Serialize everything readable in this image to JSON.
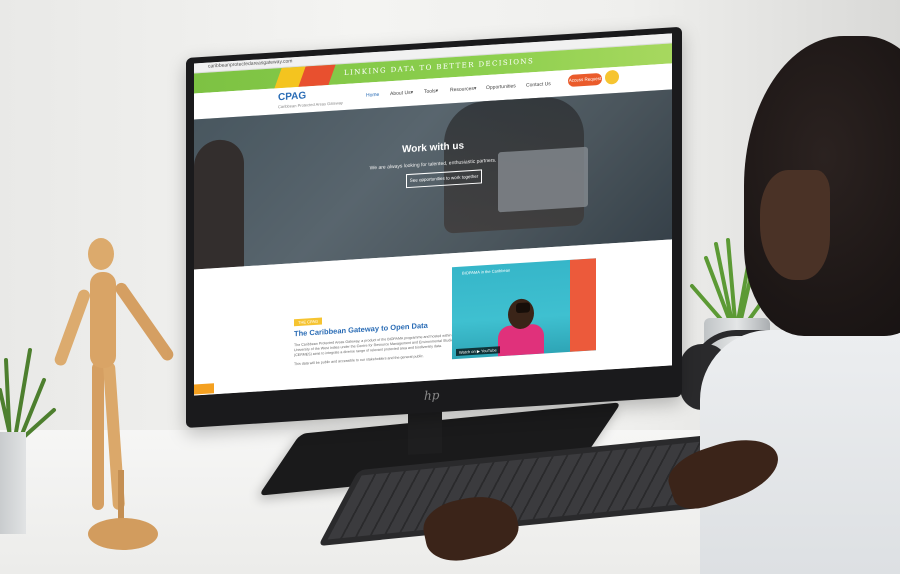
{
  "site": {
    "url": "caribbeanprotectedareasgateway.com",
    "banner": "LINKING DATA TO BETTER DECISIONS",
    "logo": "CPAG",
    "logo_sub": "Caribbean Protected Areas Gateway",
    "nav": [
      "Home",
      "About Us▾",
      "Tools▾",
      "Resources▾",
      "Opportunities",
      "Contact Us"
    ],
    "access_button": "Access Request"
  },
  "hero": {
    "title": "Work with us",
    "subtitle": "We are always looking for talented, enthusiastic partners.",
    "button": "See opportunities to work together"
  },
  "section": {
    "tag": "THE CPAG",
    "title": "The Caribbean Gateway to Open Data",
    "body": "The Caribbean Protected Areas Gateway, a product of the BIOPAMA programme and hosted within the University of the West Indies under the Centre for Resource Management and Environmental Studies (CERMES) aims to integrate a diverse range of relevant protected area and biodiversity data.",
    "body2": "This data will be public and accessible to our stakeholders and the general public.",
    "video_title": "BIOPAMA in the Caribbean",
    "video_watch": "Watch on ▶ YouTube"
  },
  "monitor": {
    "brand": "hp"
  },
  "colors": {
    "green": "#7dc243",
    "yellow": "#f4c41f",
    "orange": "#ea5b2b",
    "blue": "#2a6cb5"
  }
}
